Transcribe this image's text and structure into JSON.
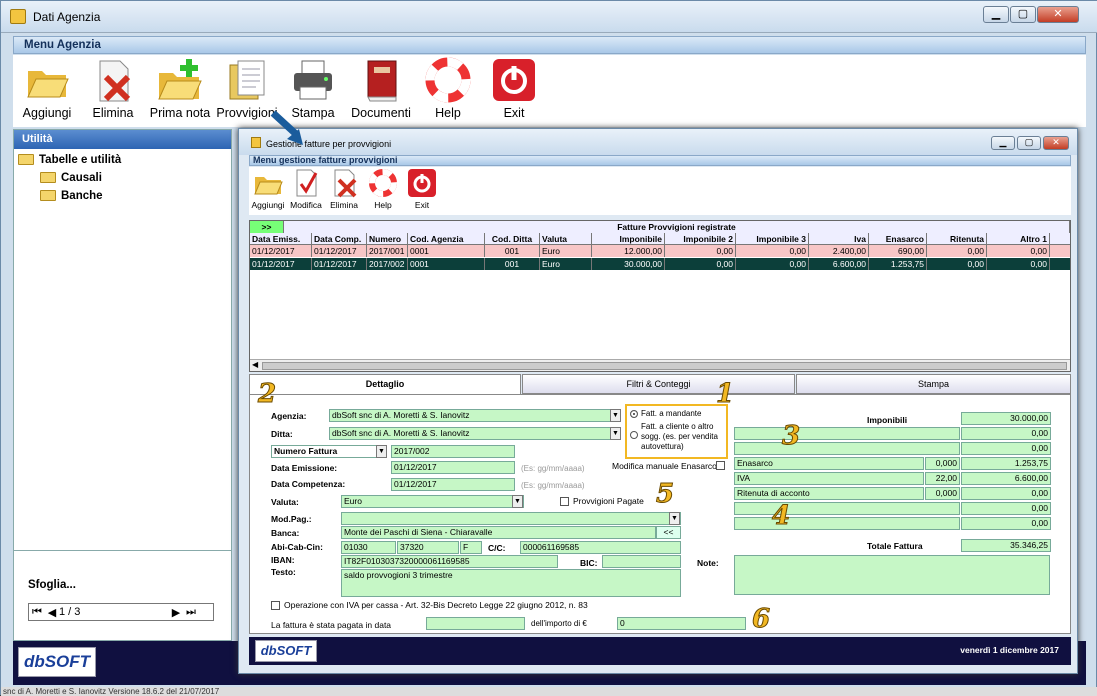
{
  "window": {
    "title": "Dati Agenzia"
  },
  "menu": {
    "title": "Menu Agenzia"
  },
  "toolbar": [
    {
      "label": "Aggiungi"
    },
    {
      "label": "Elimina"
    },
    {
      "label": "Prima nota"
    },
    {
      "label": "Provvigioni"
    },
    {
      "label": "Stampa"
    },
    {
      "label": "Documenti"
    },
    {
      "label": "Help"
    },
    {
      "label": "Exit"
    }
  ],
  "sidebar": {
    "header": "Utilità",
    "root": "Tabelle e utilità",
    "children": [
      "Causali",
      "Banche"
    ]
  },
  "browser": {
    "title": "Sfoglia...",
    "page": "1 / 3"
  },
  "logo": "dbSOFT",
  "status_text": "snc di A. Moretti e S. Ianovitz        Versione 18.6.2 del 21/07/2017",
  "inner": {
    "title": "Gestione fatture per provvigioni",
    "menu": "Menu gestione fatture provvigioni",
    "toolbar": [
      "Aggiungi",
      "Modifica",
      "Elimina",
      "Help",
      "Exit"
    ],
    "grid": {
      "caption": "Fatture Provvigioni registrate",
      "expander": ">>",
      "columns": [
        "Data Emiss.",
        "Data Comp.",
        "Numero",
        "Cod. Agenzia",
        "Cod. Ditta",
        "Valuta",
        "Imponibile",
        "Imponibile 2",
        "Imponibile 3",
        "Iva",
        "Enasarco",
        "Ritenuta",
        "Altro 1"
      ],
      "rows": [
        [
          "01/12/2017",
          "01/12/2017",
          "2017/001",
          "0001",
          "001",
          "Euro",
          "12.000,00",
          "0,00",
          "0,00",
          "2.400,00",
          "690,00",
          "0,00",
          "0,00"
        ],
        [
          "01/12/2017",
          "01/12/2017",
          "2017/002",
          "0001",
          "001",
          "Euro",
          "30.000,00",
          "0,00",
          "0,00",
          "6.600,00",
          "1.253,75",
          "0,00",
          "0,00"
        ]
      ]
    },
    "tabs": [
      "Dettaglio",
      "Filtri & Conteggi",
      "Stampa"
    ],
    "form": {
      "agenzia_label": "Agenzia:",
      "agenzia": "dbSoft snc di A. Moretti & S. Ianovitz",
      "ditta_label": "Ditta:",
      "ditta": "dbSoft snc di A. Moretti & S. Ianovitz",
      "numero_label": "Numero Fattura",
      "numero": "2017/002",
      "emissione_label": "Data Emissione:",
      "emissione": "01/12/2017",
      "competenza_label": "Data Competenza:",
      "competenza": "01/12/2017",
      "date_hint": "(Es: gg/mm/aaaa)",
      "valuta_label": "Valuta:",
      "valuta": "Euro",
      "provv_pagate": "Provvigioni Pagate",
      "modpag_label": "Mod.Pag.:",
      "modpag": "",
      "banca_label": "Banca:",
      "banca": "Monte dei Paschi di Siena - Chiaravalle",
      "banca_btn": "<<",
      "abi_label": "Abi-Cab-Cin:",
      "abi": "01030",
      "cab": "37320",
      "cin": "F",
      "cc_label": "C/C:",
      "cc": "000061169585",
      "iban_label": "IBAN:",
      "iban": "IT82F0103037320000061169585",
      "bic_label": "BIC:",
      "bic": "",
      "testo_label": "Testo:",
      "testo": "saldo provvogioni 3 trimestre",
      "note_label": "Note:",
      "radio1": "Fatt. a mandante",
      "radio2": "Fatt. a cliente o altro sogg. (es. per vendita autovettura)",
      "modifica_enasarco": "Modifica manuale Enasarco",
      "iva_cassa": "Operazione con IVA per cassa - Art. 32-Bis Decreto Legge 22 giugno 2012, n. 83",
      "pagata_label": "La fattura è stata pagata in data",
      "pagata": "",
      "importo_label": "dell'importo di €",
      "importo": "0"
    },
    "totals": {
      "imponibili_label": "Imponibili",
      "imponibili": [
        "30.000,00",
        "0,00",
        "0,00"
      ],
      "enasarco_label": "Enasarco",
      "enasarco_rate": "0,000",
      "enasarco": "1.253,75",
      "iva_label": "IVA",
      "iva_rate": "22,00",
      "iva": "6.600,00",
      "ritenuta_label": "Ritenuta di acconto",
      "ritenuta_rate": "0,000",
      "ritenuta": "0,00",
      "extra": [
        "0,00",
        "0,00"
      ],
      "totale_label": "Totale Fattura",
      "totale": "35.346,25"
    },
    "date_footer": "venerdì 1 dicembre 2017",
    "annotations": [
      "1",
      "2",
      "3",
      "4",
      "5",
      "6"
    ]
  }
}
